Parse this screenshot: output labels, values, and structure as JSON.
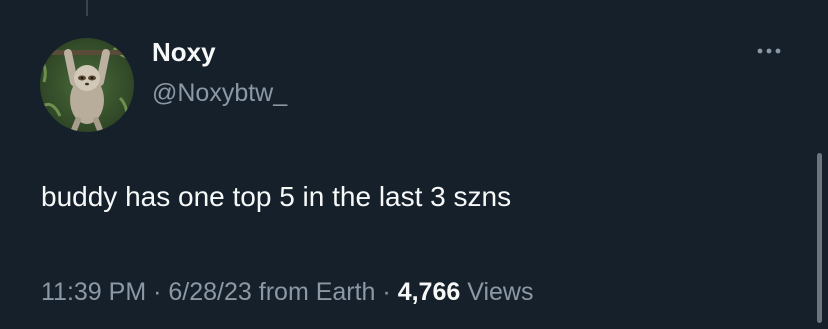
{
  "tweet": {
    "display_name": "Noxy",
    "handle": "@Noxybtw_",
    "text": "buddy has one top 5 in the last 3 szns",
    "time": "11:39 PM",
    "date": "6/28/23",
    "source": "from Earth",
    "separator": "·",
    "views_count": "4,766",
    "views_label": "Views",
    "avatar_icon": "sloth-avatar",
    "more_icon": "more-horizontal-icon"
  },
  "colors": {
    "background": "#15202b",
    "primary_text": "#f7f9f9",
    "secondary_text": "#8b98a5"
  }
}
